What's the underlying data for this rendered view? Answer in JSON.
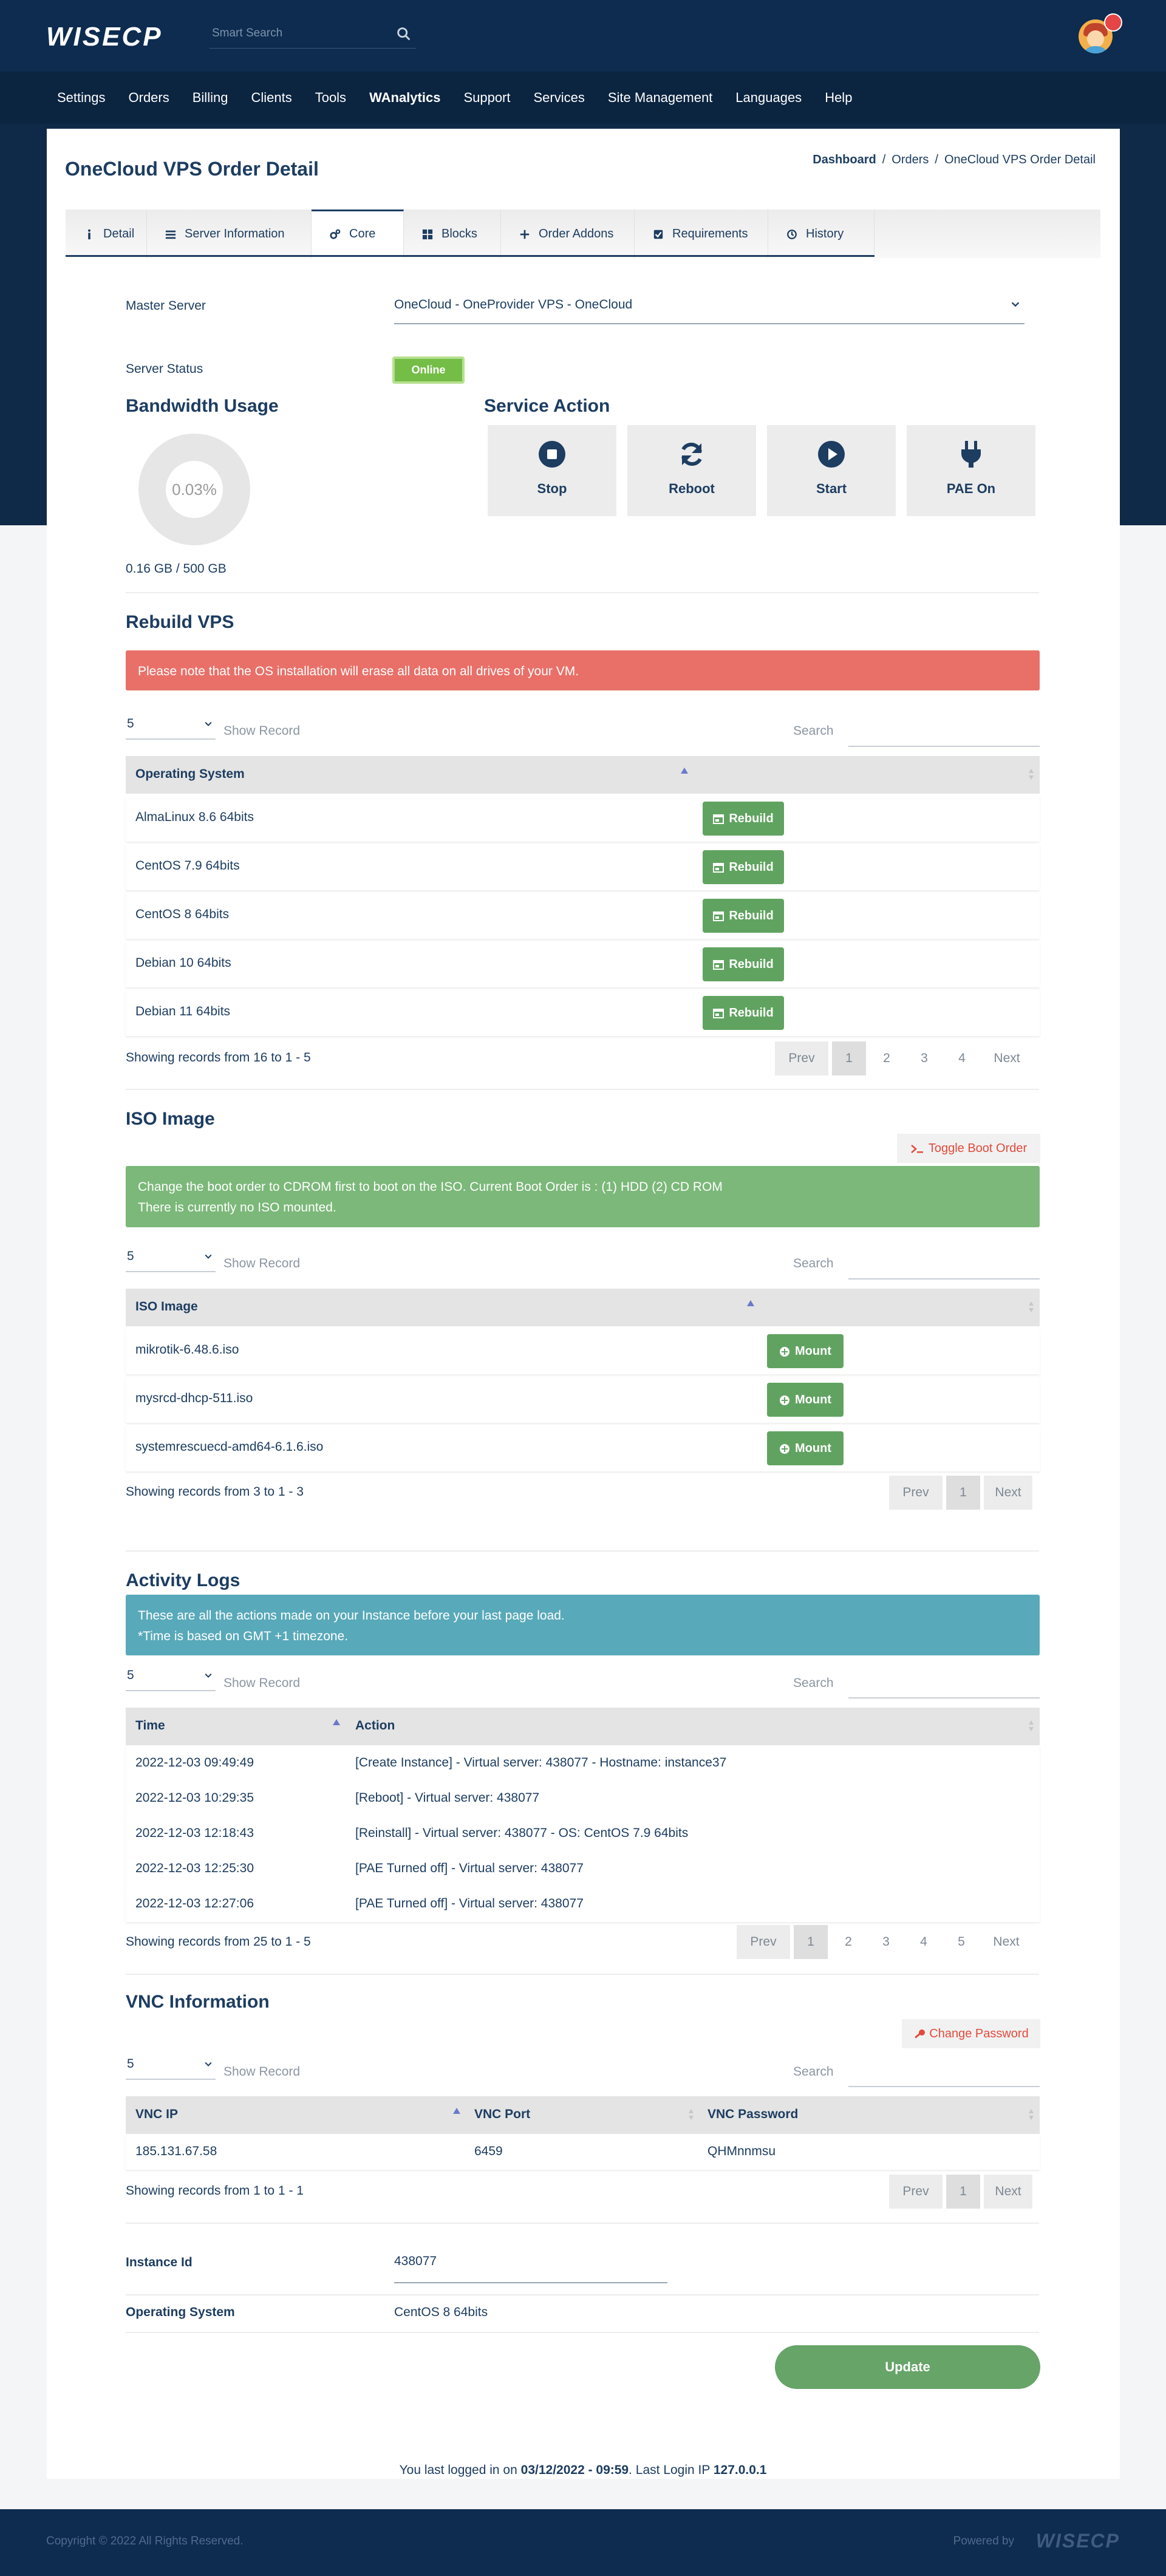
{
  "header": {
    "logo": "WISECP",
    "search_placeholder": "Smart Search",
    "nav": [
      "Settings",
      "Orders",
      "Billing",
      "Clients",
      "Tools",
      "WAnalytics",
      "Support",
      "Services",
      "Site Management",
      "Languages",
      "Help"
    ]
  },
  "page": {
    "title": "OneCloud VPS Order Detail",
    "breadcrumb": [
      "Dashboard",
      "Orders",
      "OneCloud VPS Order Detail"
    ]
  },
  "tabs": [
    "Detail",
    "Server Information",
    "Core",
    "Blocks",
    "Order Addons",
    "Requirements",
    "History"
  ],
  "active_tab": "Core",
  "core": {
    "master_server_label": "Master Server",
    "master_server_value": "OneCloud - OneProvider VPS - OneCloud",
    "server_status_label": "Server Status",
    "server_status_value": "Online",
    "bandwidth_title": "Bandwidth Usage",
    "bandwidth_percent": "0.03%",
    "bandwidth_fraction": 0.0003,
    "bandwidth_text": "0.16 GB / 500 GB",
    "service_action_title": "Service Action",
    "actions": [
      "Stop",
      "Reboot",
      "Start",
      "PAE On"
    ]
  },
  "rebuild": {
    "title": "Rebuild VPS",
    "alert": "Please note that the OS installation will erase all data on all drives of your VM.",
    "page_size": "5",
    "show_record": "Show Record",
    "search_label": "Search",
    "column": "Operating System",
    "button": "Rebuild",
    "rows": [
      "AlmaLinux 8.6 64bits",
      "CentOS 7.9 64bits",
      "CentOS 8 64bits",
      "Debian 10 64bits",
      "Debian 11 64bits"
    ],
    "showing": "Showing records from 16 to 1 - 5",
    "pager": [
      "Prev",
      "1",
      "2",
      "3",
      "4",
      "Next"
    ]
  },
  "iso": {
    "title": "ISO Image",
    "toggle_button": "Toggle Boot Order",
    "alert_line1": "Change the boot order to CDROM first to boot on the ISO. Current Boot Order is : (1) HDD (2) CD ROM",
    "alert_line2": "There is currently no ISO mounted.",
    "page_size": "5",
    "show_record": "Show Record",
    "search_label": "Search",
    "column": "ISO Image",
    "button": "Mount",
    "rows": [
      "mikrotik-6.48.6.iso",
      "mysrcd-dhcp-511.iso",
      "systemrescuecd-amd64-6.1.6.iso"
    ],
    "showing": "Showing records from 3 to 1 - 3",
    "pager": [
      "Prev",
      "1",
      "Next"
    ]
  },
  "logs": {
    "title": "Activity Logs",
    "alert_line1": "These are all the actions made on your Instance before your last page load.",
    "alert_line2": "*Time is based on GMT +1 timezone.",
    "page_size": "5",
    "show_record": "Show Record",
    "search_label": "Search",
    "columns": [
      "Time",
      "Action"
    ],
    "rows": [
      {
        "time": "2022-12-03 09:49:49",
        "action": "[Create Instance] - Virtual server: 438077 - Hostname: instance37"
      },
      {
        "time": "2022-12-03 10:29:35",
        "action": "[Reboot] - Virtual server: 438077"
      },
      {
        "time": "2022-12-03 12:18:43",
        "action": "[Reinstall] - Virtual server: 438077 - OS: CentOS 7.9 64bits"
      },
      {
        "time": "2022-12-03 12:25:30",
        "action": "[PAE Turned off] - Virtual server: 438077"
      },
      {
        "time": "2022-12-03 12:27:06",
        "action": "[PAE Turned off] - Virtual server: 438077"
      }
    ],
    "showing": "Showing records from 25 to 1 - 5",
    "pager": [
      "Prev",
      "1",
      "2",
      "3",
      "4",
      "5",
      "Next"
    ]
  },
  "vnc": {
    "title": "VNC Information",
    "change_button": "Change Password",
    "page_size": "5",
    "show_record": "Show Record",
    "search_label": "Search",
    "columns": [
      "VNC IP",
      "VNC Port",
      "VNC Password"
    ],
    "row": {
      "ip": "185.131.67.58",
      "port": "6459",
      "password": "QHMnnmsu"
    },
    "showing": "Showing records from 1 to 1 - 1",
    "pager": [
      "Prev",
      "1",
      "Next"
    ]
  },
  "info": {
    "instance_label": "Instance Id",
    "instance_value": "438077",
    "os_label": "Operating System",
    "os_value": "CentOS 8 64bits",
    "update_button": "Update"
  },
  "last_login": {
    "prefix": "You last logged in on",
    "date": "03/12/2022 - 09:59",
    "mid": ". Last Login IP",
    "ip": "127.0.0.1"
  },
  "footer": {
    "copyright": "Copyright © 2022 All Rights Reserved.",
    "powered": "Powered by",
    "powered_logo": "WISECP"
  }
}
